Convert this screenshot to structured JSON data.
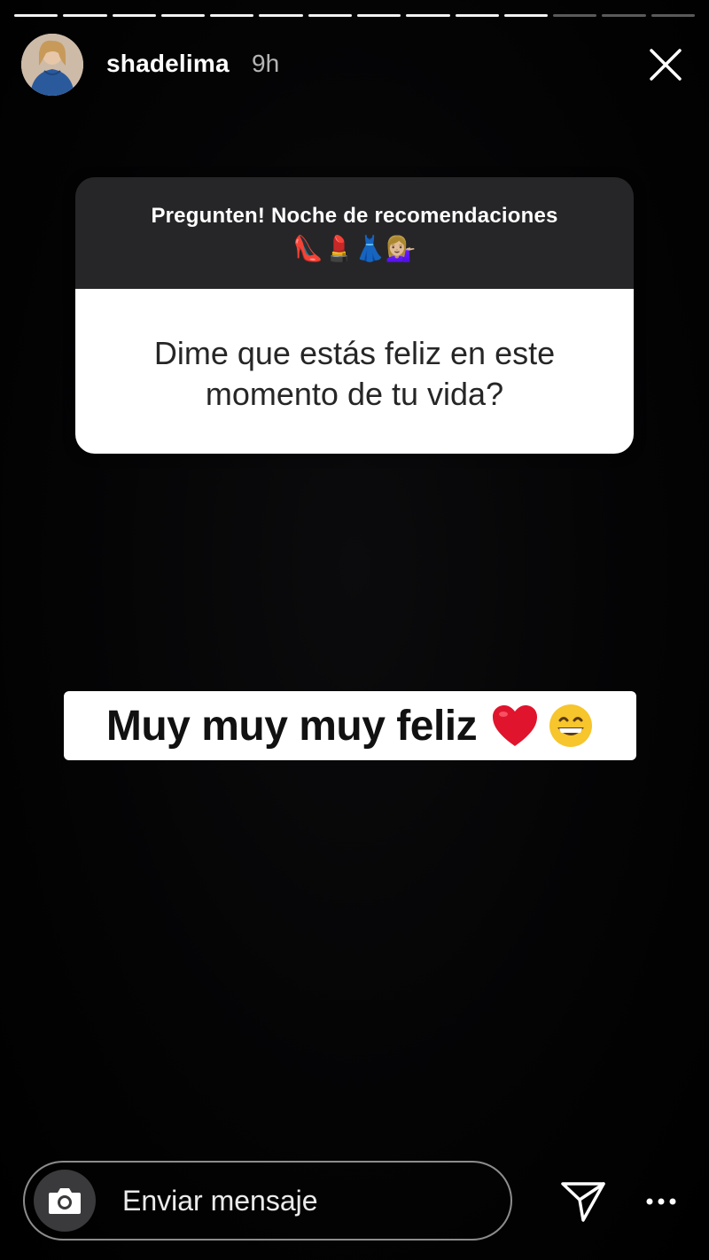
{
  "story": {
    "progress_segments": 14,
    "seen_segments": 11
  },
  "header": {
    "username": "shadelima",
    "time": "9h"
  },
  "question": {
    "title": "Pregunten! Noche de recomendaciones",
    "emojis": "👠💄👗💁🏼‍♀️",
    "text": "Dime que estás feliz en este momento de tu vida?"
  },
  "answer": {
    "text": "Muy muy muy feliz"
  },
  "footer": {
    "message_placeholder": "Enviar mensaje"
  },
  "colors": {
    "background": "#000000",
    "question_header": "#262628",
    "question_body": "#ffffff",
    "heart": "#e0142d",
    "smile": "#f7c52c"
  },
  "icons": [
    "close-icon",
    "camera-icon",
    "send-icon",
    "more-icon",
    "heart-icon",
    "grin-icon"
  ]
}
